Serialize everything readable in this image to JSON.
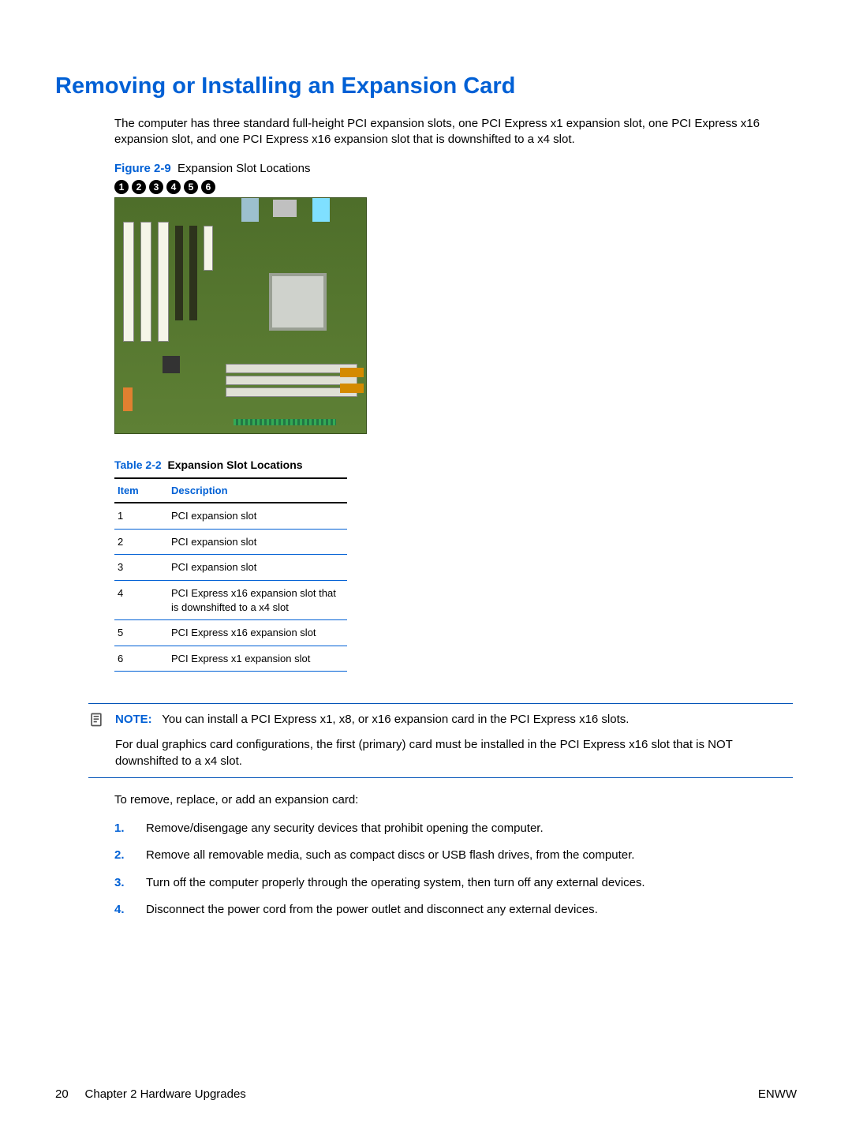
{
  "title": "Removing or Installing an Expansion Card",
  "intro": "The computer has three standard full-height PCI expansion slots, one PCI Express x1 expansion slot, one PCI Express x16 expansion slot, and one PCI Express x16 expansion slot that is downshifted to a x4 slot.",
  "figure": {
    "label": "Figure 2-9",
    "caption": "Expansion Slot Locations",
    "callouts": [
      "1",
      "2",
      "3",
      "4",
      "5",
      "6"
    ]
  },
  "table": {
    "label": "Table 2-2",
    "title": "Expansion Slot Locations",
    "headers": {
      "item": "Item",
      "desc": "Description"
    },
    "rows": [
      {
        "item": "1",
        "desc": "PCI expansion slot"
      },
      {
        "item": "2",
        "desc": "PCI expansion slot"
      },
      {
        "item": "3",
        "desc": "PCI expansion slot"
      },
      {
        "item": "4",
        "desc": "PCI Express x16 expansion slot that is downshifted to a x4 slot"
      },
      {
        "item": "5",
        "desc": "PCI Express x16 expansion slot"
      },
      {
        "item": "6",
        "desc": "PCI Express x1 expansion slot"
      }
    ]
  },
  "note": {
    "label": "NOTE:",
    "p1": "You can install a PCI Express x1, x8, or x16 expansion card in the PCI Express x16 slots.",
    "p2": "For dual graphics card configurations, the first (primary) card must be installed in the PCI Express x16 slot that is NOT downshifted to a x4 slot."
  },
  "lead_sentence": "To remove, replace, or add an expansion card:",
  "steps": [
    {
      "n": "1.",
      "t": "Remove/disengage any security devices that prohibit opening the computer."
    },
    {
      "n": "2.",
      "t": "Remove all removable media, such as compact discs or USB flash drives, from the computer."
    },
    {
      "n": "3.",
      "t": "Turn off the computer properly through the operating system, then turn off any external devices."
    },
    {
      "n": "4.",
      "t": "Disconnect the power cord from the power outlet and disconnect any external devices."
    }
  ],
  "footer": {
    "left_page": "20",
    "left_chapter": "Chapter 2   Hardware Upgrades",
    "right": "ENWW"
  }
}
